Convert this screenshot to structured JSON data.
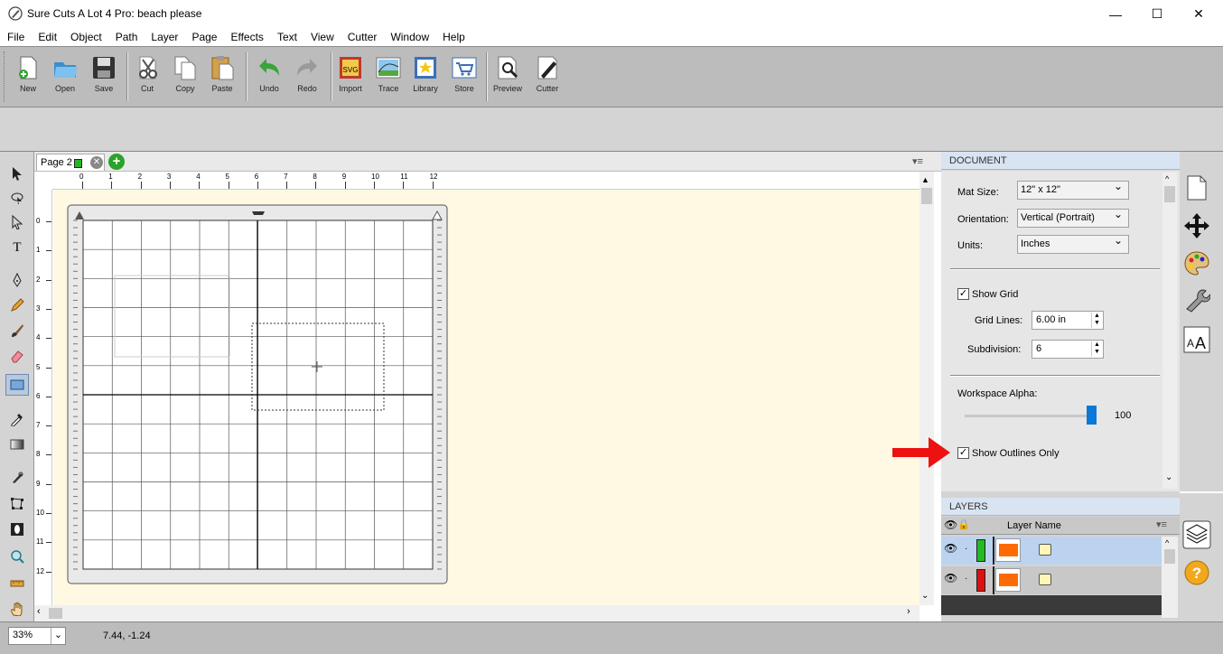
{
  "window": {
    "title": "Sure Cuts A Lot 4 Pro: beach please",
    "minimize": "—",
    "maximize": "☐",
    "close": "✕"
  },
  "menu": [
    "File",
    "Edit",
    "Object",
    "Path",
    "Layer",
    "Page",
    "Effects",
    "Text",
    "View",
    "Cutter",
    "Window",
    "Help"
  ],
  "toolbar": {
    "new": "New",
    "open": "Open",
    "save": "Save",
    "cut": "Cut",
    "copy": "Copy",
    "paste": "Paste",
    "undo": "Undo",
    "redo": "Redo",
    "import": "Import",
    "trace": "Trace",
    "library": "Library",
    "store": "Store",
    "preview": "Preview",
    "cutter": "Cutter"
  },
  "tabs": {
    "page": "Page 2"
  },
  "ruler": {
    "h": [
      "0",
      "1",
      "2",
      "3",
      "4",
      "5",
      "6",
      "7",
      "8",
      "9",
      "10",
      "11",
      "12"
    ],
    "v": [
      "0",
      "1",
      "2",
      "3",
      "4",
      "5",
      "6",
      "7",
      "8",
      "9",
      "10",
      "11",
      "12"
    ]
  },
  "status": {
    "zoom": "33%",
    "coords": "7.44, -1.24"
  },
  "document": {
    "header": "DOCUMENT",
    "mat_size_label": "Mat Size:",
    "mat_size_value": "12\" x 12\"",
    "orientation_label": "Orientation:",
    "orientation_value": "Vertical (Portrait)",
    "units_label": "Units:",
    "units_value": "Inches",
    "show_grid_label": "Show Grid",
    "show_grid_checked": true,
    "grid_lines_label": "Grid Lines:",
    "grid_lines_value": "6.00 in",
    "subdivision_label": "Subdivision:",
    "subdivision_value": "6",
    "workspace_alpha_label": "Workspace Alpha:",
    "workspace_alpha_value": "100",
    "show_outlines_label": "Show Outlines Only",
    "show_outlines_checked": true
  },
  "layers": {
    "header": "LAYERS",
    "column_name": "Layer Name",
    "rows": [
      {
        "color": "#22bb22",
        "fill": "#ff6a00",
        "selected": true
      },
      {
        "color": "#dd1111",
        "fill": "#ff6a00",
        "selected": false
      }
    ]
  },
  "colors": {
    "toolbar_bg": "#bcbcbc",
    "canvas_bg": "#fff8e3",
    "panel_header": "#d9e4f2",
    "annotation_arrow": "#ee1111",
    "layer_selected": "#bcd3f0"
  }
}
